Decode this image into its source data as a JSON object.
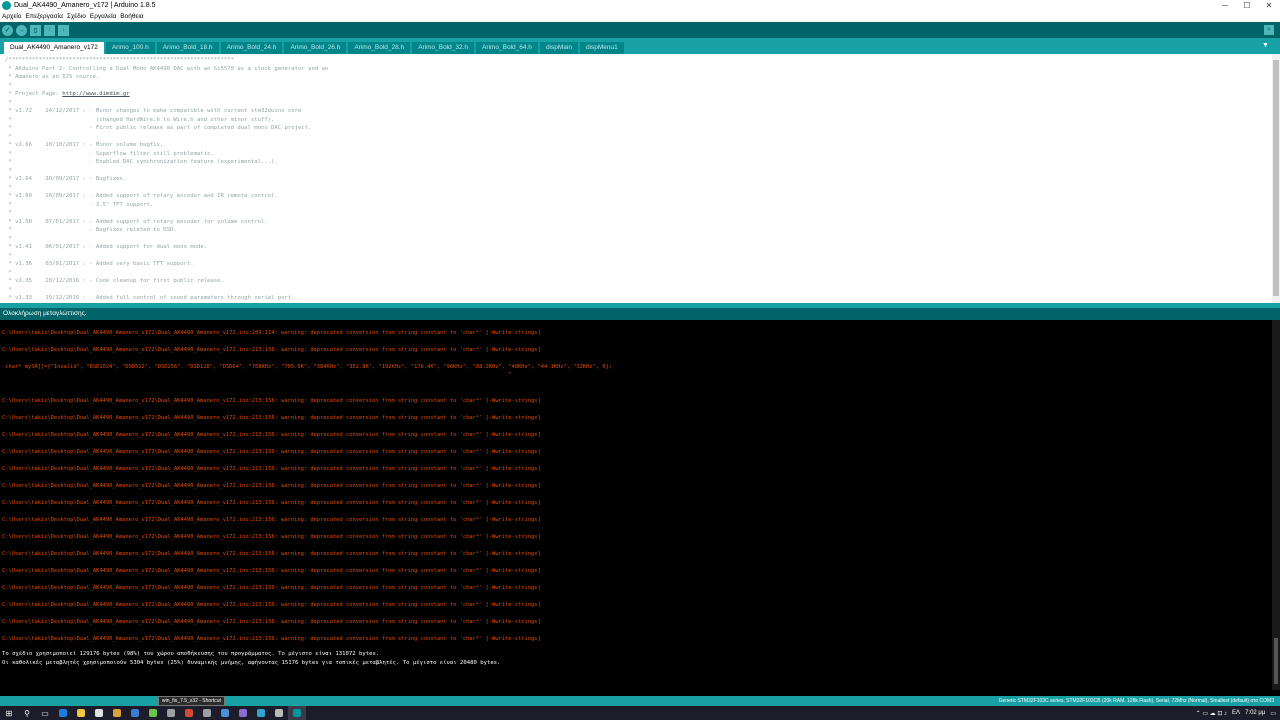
{
  "window": {
    "title": "Dual_AK4490_Amanero_v172 | Arduino 1.8.5",
    "minimize": "─",
    "maximize": "☐",
    "close": "✕"
  },
  "menu": [
    "Αρχείο",
    "Επεξεργασία",
    "Σχέδιο",
    "Εργαλεία",
    "Βοήθεια"
  ],
  "toolbar": {
    "verify": "✓",
    "upload": "→",
    "new": "▯",
    "open": "↑",
    "save": "↓",
    "serial_monitor": "⌕"
  },
  "tabs": [
    "Dual_AK4490_Amanero_v172",
    "Arimo_100.h",
    "Arimo_Bold_18.h",
    "Arimo_Bold_24.h",
    "Arimo_Bold_26.h",
    "Arimo_Bold_28.h",
    "Arimo_Bold_32.h",
    "Arimo_Bold_64.h",
    "dispMain",
    "dispMenu1"
  ],
  "tab_menu": "▼",
  "code_lines": [
    "/*******************************************************************",
    " * AKduino Part 2: Controlling a Dual Mono AK4490 DAC with an Si5570 as a clock generator and an",
    " * Amanero as an I2S source.",
    " *",
    " * Project Page: http://www.dimdim.gr",
    " *",
    " * v1.72    24/12/2017 : - Minor changes to make compatible with current stm32duino core",
    " *                         (changed HardWire.h to Wire.h and other minor stuff).",
    " *                       - First public release as part of completed dual mono DAC project.",
    " *",
    " * v1.66    10/10/2017 : - Minor volume bugfix.",
    " *                       - Superflow filter still problematic.",
    " *                       - Enabled DAC synchronization feature (experimental...).",
    " *",
    " * v1.64    30/09/2017 : - Bugfixes.",
    " *",
    " * v1.60    20/09/2017 : - Added support of rotary encoder and IR remote control.",
    " *                       - 3.5\" TFT support.",
    " *",
    " * v1.50    07/01/2017 : - Added support of rotary encoder for volume control.",
    " *                       - Bugfixes related to DSD.",
    " *",
    " * v1.41    06/01/2017 : - Added support for dual mono mode.",
    " *",
    " * v1.36    03/01/2017 : - Added very basic TFT support.",
    " *",
    " * v1.35    20/12/2016 : - Code cleanup for first public release.",
    " *",
    " * v1.33    19/12/2016 : - Added full control of sound parameters through serial port."
  ],
  "message_bar": "Ολοκλήρωση μεταγλώττισης.",
  "console_lines": [
    "C:\\Users\\takis\\Desktop\\Dual_AK4490_Amanero_v172\\Dual_AK4490_Amanero_v172.ino:209:114: warning: deprecated conversion from string constant to 'char*' [-Wwrite-strings]",
    "C:\\Users\\takis\\Desktop\\Dual_AK4490_Amanero_v172\\Dual_AK4490_Amanero_v172.ino:213:156: warning: deprecated conversion from string constant to 'char*' [-Wwrite-strings]",
    " char* mySR[]={\"Invalid\", \"DSD1024\", \"DSD512\", \"DSD256\", \"DSD128\", \"DSD64\", \"768KHz\", \"705.6K\", \"384KHz\", \"352.8K\", \"192KHz\", \"176.4K\", \"96KHz\", \"88.2KHz\", \"48KHz\", \"44.1KHz\", \"32KHz\", 0};",
    "                                                                                                                                                            ^",
    "C:\\Users\\takis\\Desktop\\Dual_AK4490_Amanero_v172\\Dual_AK4490_Amanero_v172.ino:213:156: warning: deprecated conversion from string constant to 'char*' [-Wwrite-strings]",
    "C:\\Users\\takis\\Desktop\\Dual_AK4490_Amanero_v172\\Dual_AK4490_Amanero_v172.ino:213:156: warning: deprecated conversion from string constant to 'char*' [-Wwrite-strings]",
    "C:\\Users\\takis\\Desktop\\Dual_AK4490_Amanero_v172\\Dual_AK4490_Amanero_v172.ino:213:156: warning: deprecated conversion from string constant to 'char*' [-Wwrite-strings]",
    "C:\\Users\\takis\\Desktop\\Dual_AK4490_Amanero_v172\\Dual_AK4490_Amanero_v172.ino:213:156: warning: deprecated conversion from string constant to 'char*' [-Wwrite-strings]",
    "C:\\Users\\takis\\Desktop\\Dual_AK4490_Amanero_v172\\Dual_AK4490_Amanero_v172.ino:213:156: warning: deprecated conversion from string constant to 'char*' [-Wwrite-strings]",
    "C:\\Users\\takis\\Desktop\\Dual_AK4490_Amanero_v172\\Dual_AK4490_Amanero_v172.ino:213:156: warning: deprecated conversion from string constant to 'char*' [-Wwrite-strings]",
    "C:\\Users\\takis\\Desktop\\Dual_AK4490_Amanero_v172\\Dual_AK4490_Amanero_v172.ino:213:156: warning: deprecated conversion from string constant to 'char*' [-Wwrite-strings]",
    "C:\\Users\\takis\\Desktop\\Dual_AK4490_Amanero_v172\\Dual_AK4490_Amanero_v172.ino:213:156: warning: deprecated conversion from string constant to 'char*' [-Wwrite-strings]",
    "C:\\Users\\takis\\Desktop\\Dual_AK4490_Amanero_v172\\Dual_AK4490_Amanero_v172.ino:213:156: warning: deprecated conversion from string constant to 'char*' [-Wwrite-strings]",
    "C:\\Users\\takis\\Desktop\\Dual_AK4490_Amanero_v172\\Dual_AK4490_Amanero_v172.ino:213:156: warning: deprecated conversion from string constant to 'char*' [-Wwrite-strings]",
    "C:\\Users\\takis\\Desktop\\Dual_AK4490_Amanero_v172\\Dual_AK4490_Amanero_v172.ino:213:156: warning: deprecated conversion from string constant to 'char*' [-Wwrite-strings]",
    "C:\\Users\\takis\\Desktop\\Dual_AK4490_Amanero_v172\\Dual_AK4490_Amanero_v172.ino:213:156: warning: deprecated conversion from string constant to 'char*' [-Wwrite-strings]",
    "C:\\Users\\takis\\Desktop\\Dual_AK4490_Amanero_v172\\Dual_AK4490_Amanero_v172.ino:213:156: warning: deprecated conversion from string constant to 'char*' [-Wwrite-strings]",
    "C:\\Users\\takis\\Desktop\\Dual_AK4490_Amanero_v172\\Dual_AK4490_Amanero_v172.ino:213:156: warning: deprecated conversion from string constant to 'char*' [-Wwrite-strings]",
    "C:\\Users\\takis\\Desktop\\Dual_AK4490_Amanero_v172\\Dual_AK4490_Amanero_v172.ino:213:156: warning: deprecated conversion from string constant to 'char*' [-Wwrite-strings]"
  ],
  "console_summary": [
    "Το σχέδιο χρησιμοποιεί 129176 bytes (98%) του χώρου αποθήκευσης του προγράμματος. Το μέγιστο είναι 131072 bytes.",
    "Οι καθολικές μεταβλητές χρησιμοποιούν 5304 bytes (25%) δυναμικής μνήμης, αφήνοντας 15176 bytes για τοπικές μεταβλητές. Το μέγιστο είναι 20480 bytes."
  ],
  "board_info": "Generic STM32F103C series, STM32F103CB (20k RAM. 128k Flash), Serial, 72Mhz (Normal), Smallest (default) στο COM3",
  "taskbar": {
    "tooltip": "win_fix_7.5_x32 - Shortcut",
    "icons": [
      {
        "name": "windows-start-icon",
        "glyph": "⊞",
        "color": "#ffffff"
      },
      {
        "name": "search-icon",
        "glyph": "⚲",
        "color": "#ffffff"
      },
      {
        "name": "task-view-icon",
        "glyph": "▭",
        "color": "#ffffff"
      },
      {
        "name": "edge-browser-icon",
        "glyph": "",
        "color": "#1e7fd8"
      },
      {
        "name": "file-explorer-icon",
        "glyph": "",
        "color": "#f4c542"
      },
      {
        "name": "store-icon",
        "glyph": "",
        "color": "#e0e0e0"
      },
      {
        "name": "chrome-icon",
        "glyph": "",
        "color": "#d9a33b"
      },
      {
        "name": "app-icon-1",
        "glyph": "",
        "color": "#3a7bd5"
      },
      {
        "name": "app-icon-2",
        "glyph": "",
        "color": "#6cc24a"
      },
      {
        "name": "app-icon-3",
        "glyph": "",
        "color": "#a0a0a0"
      },
      {
        "name": "app-icon-4",
        "glyph": "",
        "color": "#d04a3a"
      },
      {
        "name": "app-icon-5",
        "glyph": "",
        "color": "#9aa0a6"
      },
      {
        "name": "app-icon-6",
        "glyph": "",
        "color": "#4a90d9"
      },
      {
        "name": "app-icon-7",
        "glyph": "",
        "color": "#8c6cd0"
      },
      {
        "name": "app-icon-8",
        "glyph": "",
        "color": "#2fa3d6"
      },
      {
        "name": "app-icon-9",
        "glyph": "",
        "color": "#bbbbbb"
      },
      {
        "name": "arduino-taskbar-icon",
        "glyph": "",
        "color": "#00979c",
        "active": true
      }
    ]
  },
  "tray": {
    "icons": "⌃ ▭ ☁ ⊡ ♪",
    "language": "ΕΛ",
    "time": "7:02 μμ",
    "notifications": "▭"
  },
  "colors": {
    "teal_dark": "#006468",
    "teal": "#17a1a5",
    "console_warning": "#e34c00",
    "comment": "#95a5a6"
  }
}
